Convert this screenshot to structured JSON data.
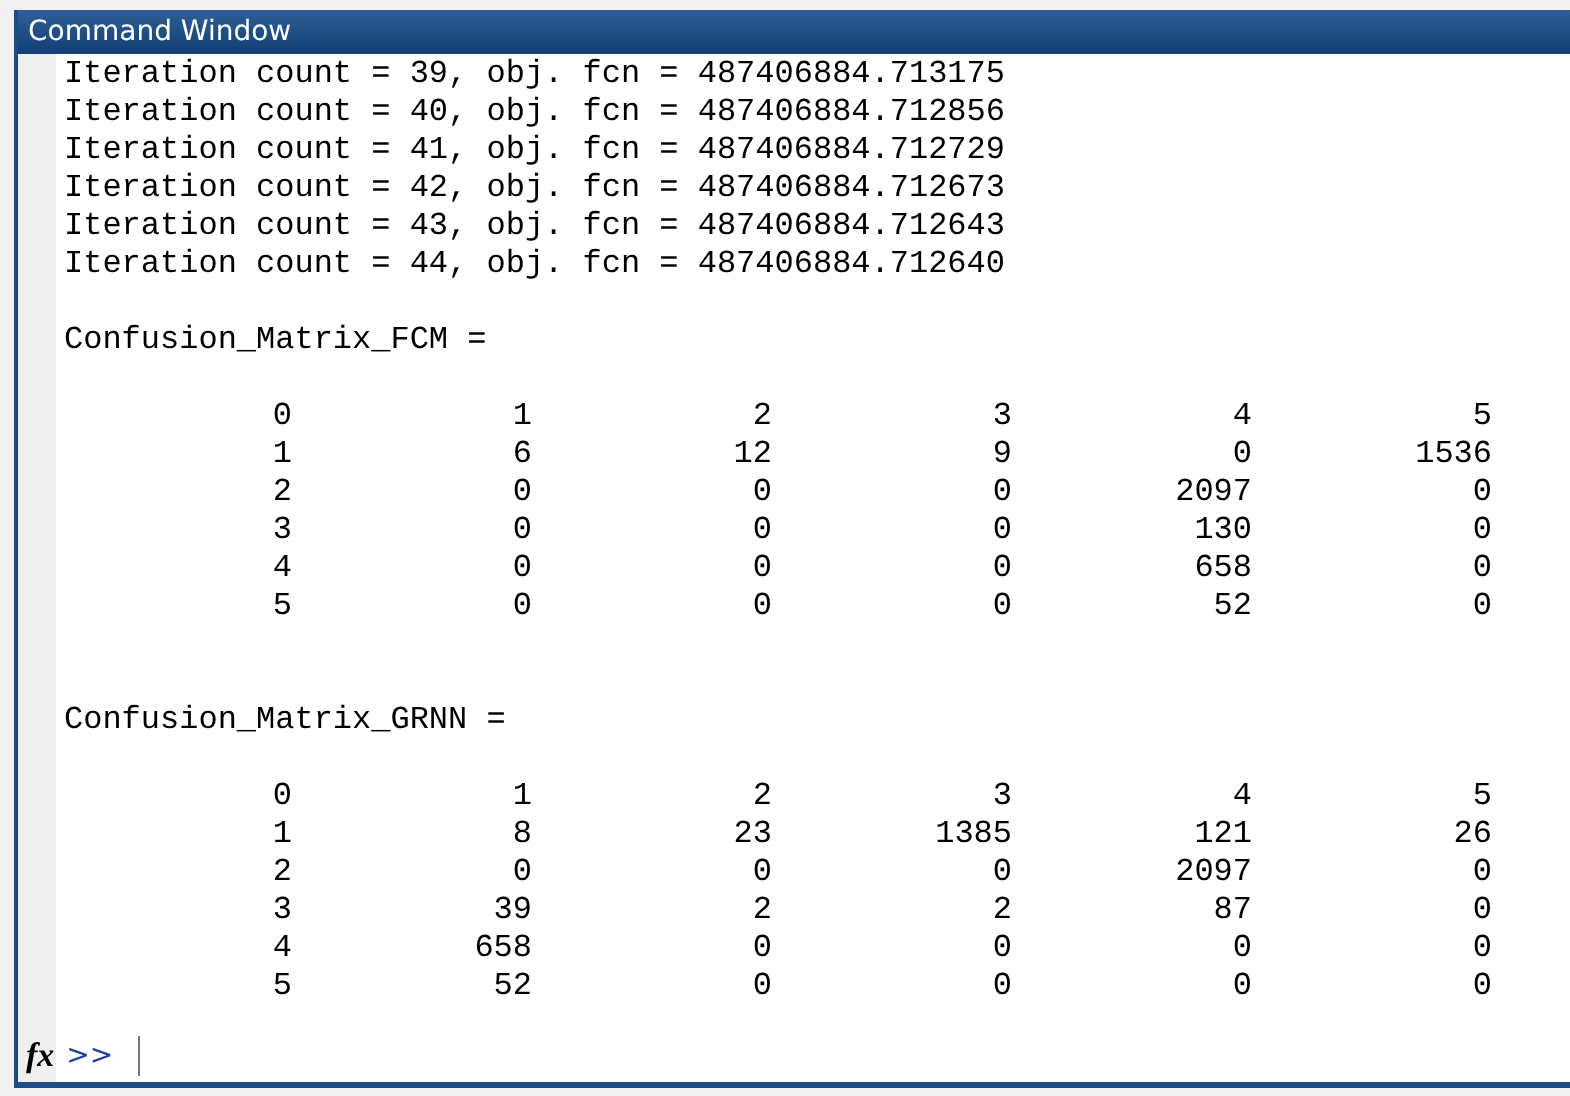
{
  "window": {
    "title": "Command Window"
  },
  "output_lines": [
    "Iteration count = 39, obj. fcn = 487406884.713175",
    "Iteration count = 40, obj. fcn = 487406884.712856",
    "Iteration count = 41, obj. fcn = 487406884.712729",
    "Iteration count = 42, obj. fcn = 487406884.712673",
    "Iteration count = 43, obj. fcn = 487406884.712643",
    "Iteration count = 44, obj. fcn = 487406884.712640"
  ],
  "matrices": [
    {
      "name": "Confusion_Matrix_FCM =",
      "rows": [
        [
          "0",
          "1",
          "2",
          "3",
          "4",
          "5"
        ],
        [
          "1",
          "6",
          "12",
          "9",
          "0",
          "1536"
        ],
        [
          "2",
          "0",
          "0",
          "0",
          "2097",
          "0"
        ],
        [
          "3",
          "0",
          "0",
          "0",
          "130",
          "0"
        ],
        [
          "4",
          "0",
          "0",
          "0",
          "658",
          "0"
        ],
        [
          "5",
          "0",
          "0",
          "0",
          "52",
          "0"
        ]
      ]
    },
    {
      "name": "Confusion_Matrix_GRNN =",
      "rows": [
        [
          "0",
          "1",
          "2",
          "3",
          "4",
          "5"
        ],
        [
          "1",
          "8",
          "23",
          "1385",
          "121",
          "26"
        ],
        [
          "2",
          "0",
          "0",
          "0",
          "2097",
          "0"
        ],
        [
          "3",
          "39",
          "2",
          "2",
          "87",
          "0"
        ],
        [
          "4",
          "658",
          "0",
          "0",
          "0",
          "0"
        ],
        [
          "5",
          "52",
          "0",
          "0",
          "0",
          "0"
        ]
      ]
    }
  ],
  "command_line": {
    "function_button": "fx",
    "prompt": ">>"
  }
}
